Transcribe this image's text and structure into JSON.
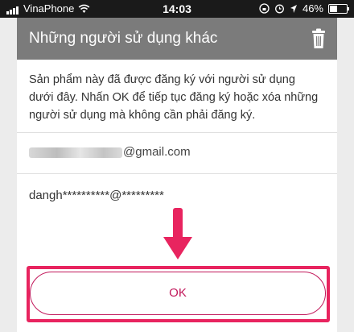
{
  "status_bar": {
    "carrier": "VinaPhone",
    "time": "14:03",
    "battery": "46%",
    "icons": [
      "signal-icon",
      "wifi-icon",
      "lock-rotation-icon",
      "alarm-icon",
      "location-icon",
      "battery-icon"
    ]
  },
  "dialog": {
    "title": "Những người sử dụng khác",
    "header_icon": "trash-icon",
    "description_lines": [
      "Sản phẩm này đã được đăng ký với người sử dụng",
      "dưới đây. Nhấn OK để tiếp tục đăng ký hoặc xóa những",
      "người sử dụng mà không cần phải đăng ký."
    ],
    "accounts": [
      {
        "visible_suffix": "@gmail.com"
      },
      {
        "text": "dangh**********@*********"
      }
    ],
    "ok_label": "OK"
  },
  "colors": {
    "header_bg": "#7b7b7b",
    "highlight": "#e8245f",
    "ok_text": "#c2185b"
  }
}
